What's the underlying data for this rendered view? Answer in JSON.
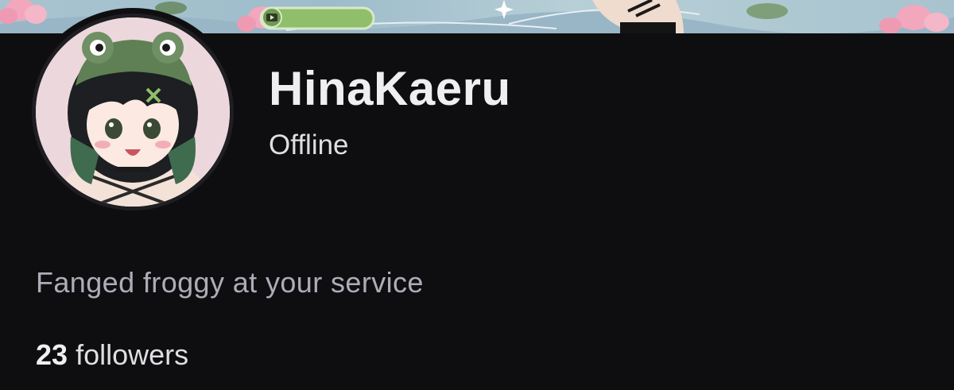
{
  "profile": {
    "display_name": "HinaKaeru",
    "status": "Offline",
    "bio": "Fanged froggy at your service",
    "followers_count": "23",
    "followers_label": "followers"
  },
  "icons": {
    "banner_badge": "youtube-icon",
    "sparkle": "sparkle-icon"
  },
  "colors": {
    "background": "#0e0e10",
    "name_text": "#efeff1",
    "bio_text": "#adadb8",
    "banner_badge": "#8fbf6a"
  }
}
